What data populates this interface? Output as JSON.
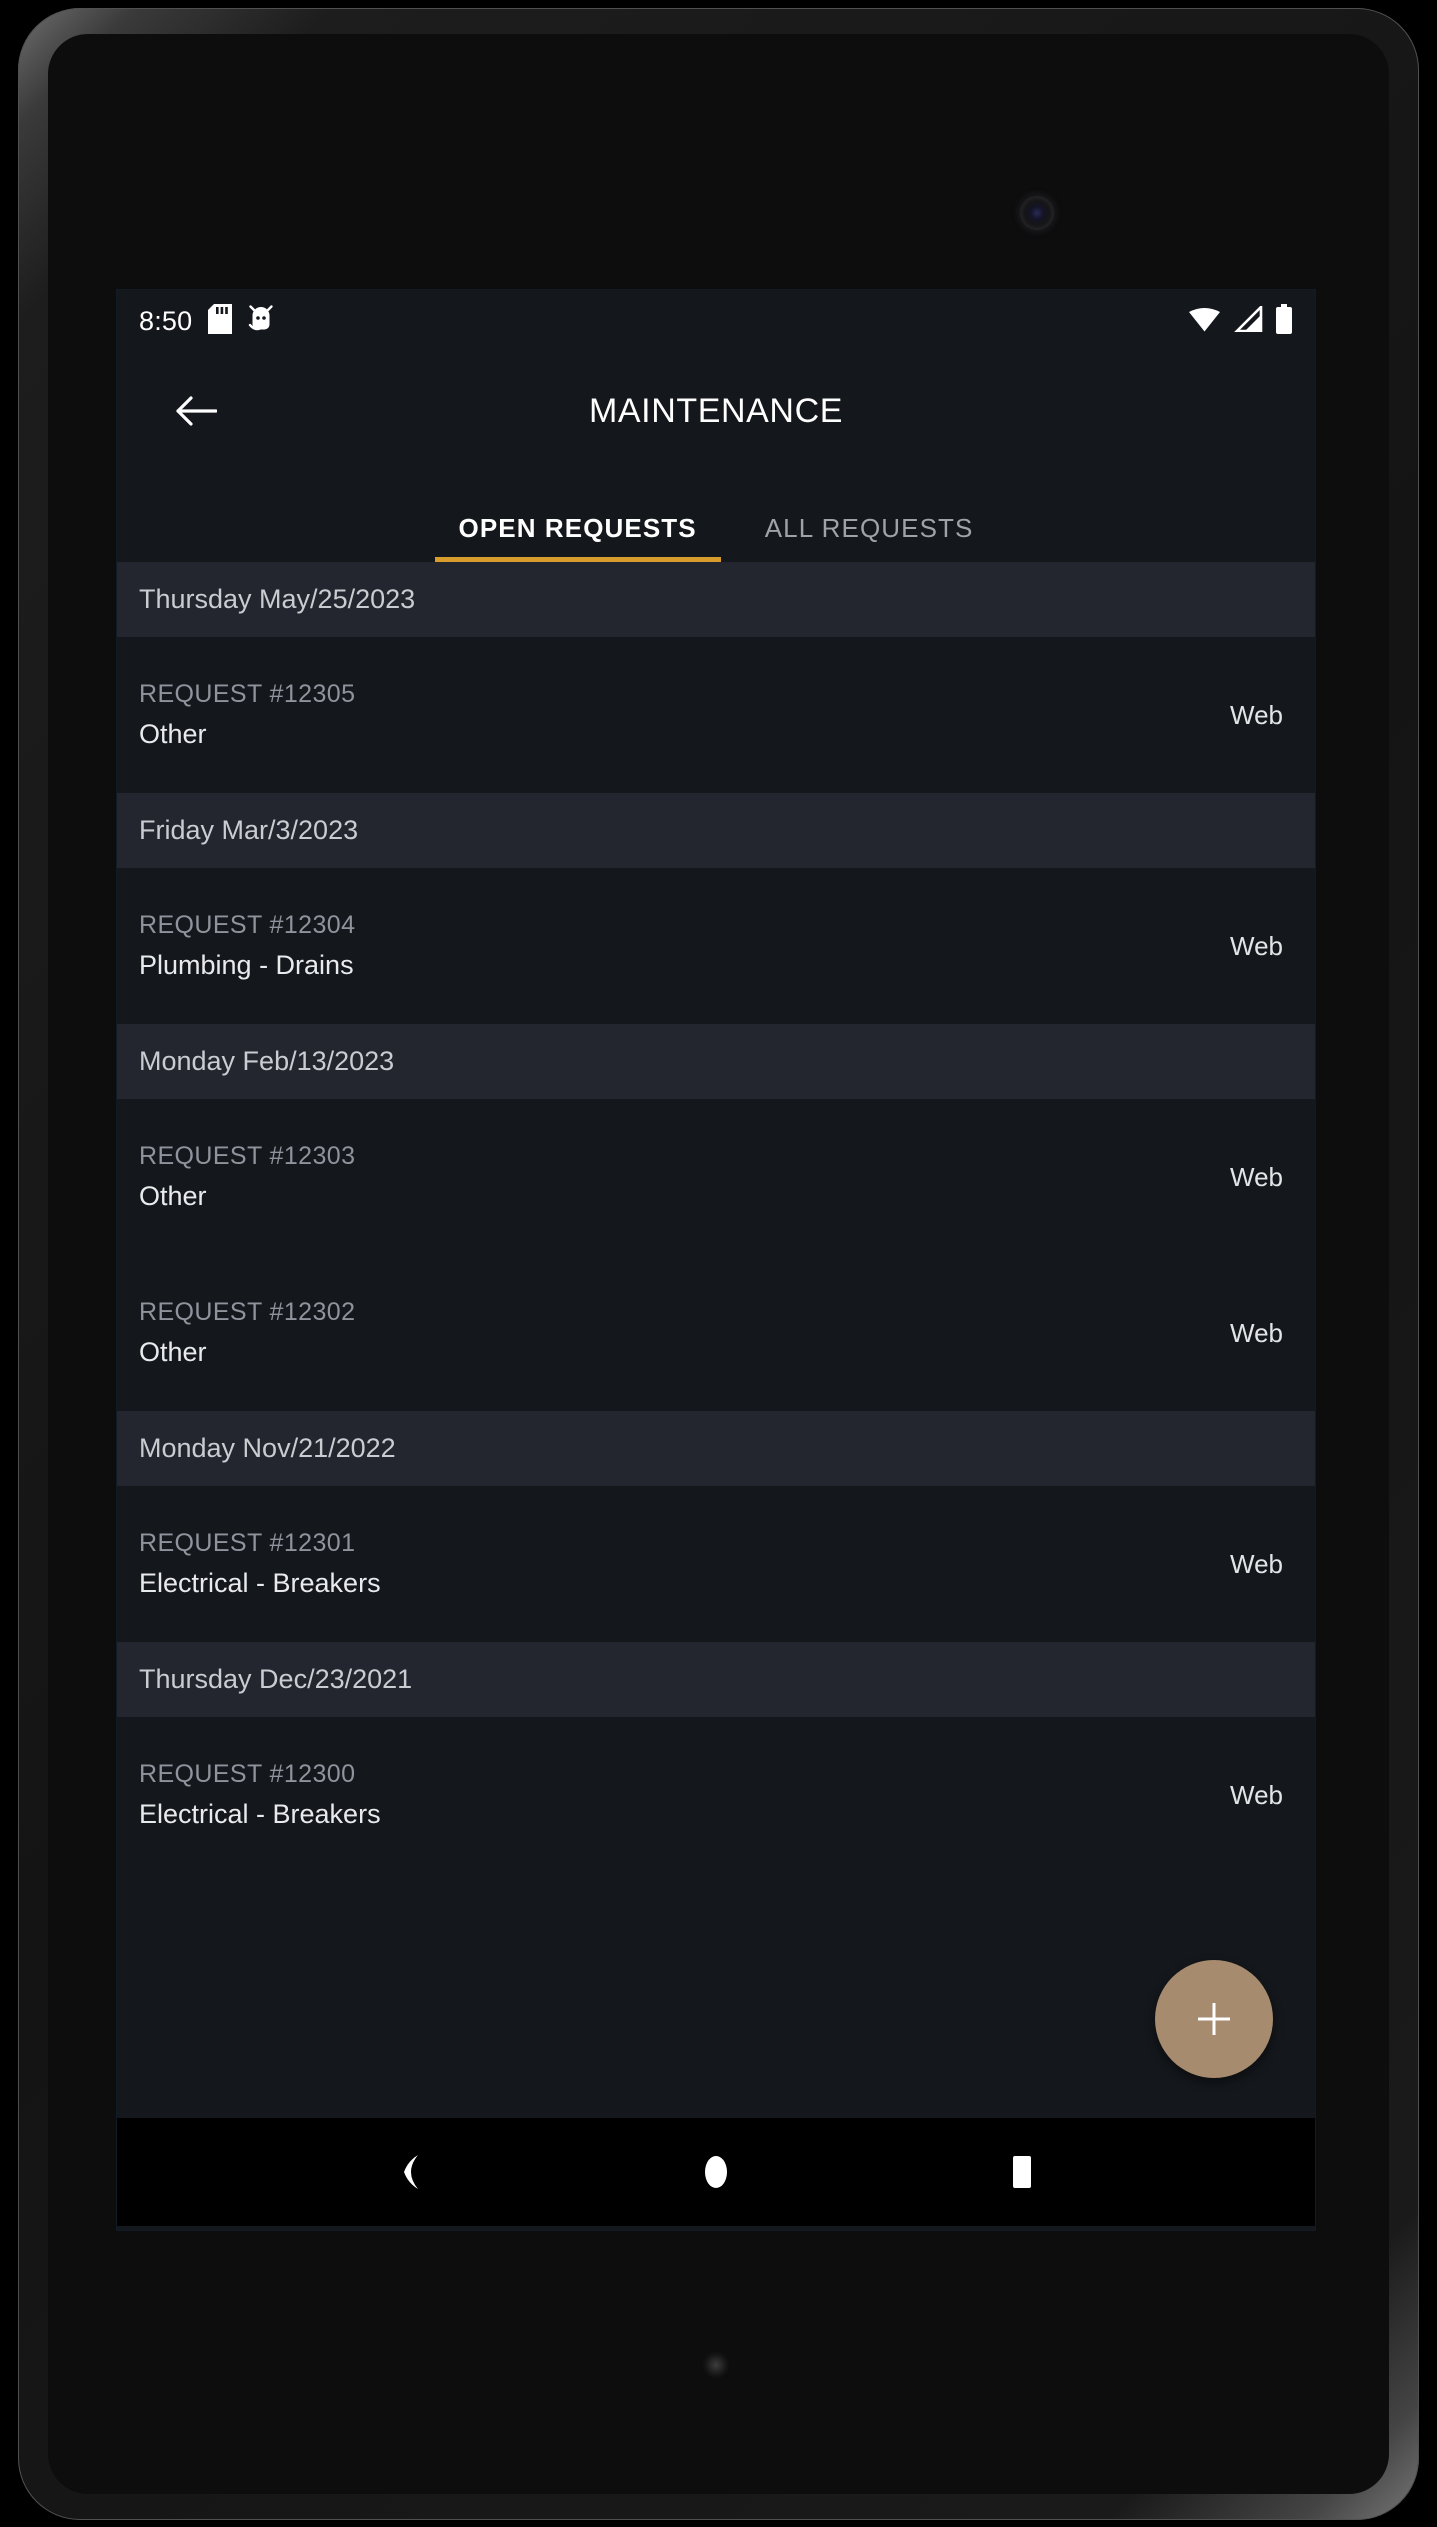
{
  "status_bar": {
    "time": "8:50",
    "left_icons": [
      "sd-card-icon",
      "android-debug-icon"
    ],
    "right_icons": [
      "wifi-icon",
      "cellular-signal-icon",
      "battery-icon"
    ]
  },
  "app_bar": {
    "back_label": "back-arrow",
    "title": "MAINTENANCE"
  },
  "tabs": [
    {
      "label": "OPEN REQUESTS",
      "active": true
    },
    {
      "label": "ALL REQUESTS",
      "active": false
    }
  ],
  "groups": [
    {
      "date": "Thursday May/25/2023",
      "requests": [
        {
          "id": "REQUEST #12305",
          "type": "Other",
          "source": "Web"
        }
      ]
    },
    {
      "date": "Friday Mar/3/2023",
      "requests": [
        {
          "id": "REQUEST #12304",
          "type": "Plumbing - Drains",
          "source": "Web"
        }
      ]
    },
    {
      "date": "Monday Feb/13/2023",
      "requests": [
        {
          "id": "REQUEST #12303",
          "type": "Other",
          "source": "Web"
        },
        {
          "id": "REQUEST #12302",
          "type": "Other",
          "source": "Web"
        }
      ]
    },
    {
      "date": "Monday Nov/21/2022",
      "requests": [
        {
          "id": "REQUEST #12301",
          "type": "Electrical - Breakers",
          "source": "Web"
        }
      ]
    },
    {
      "date": "Thursday Dec/23/2021",
      "requests": [
        {
          "id": "REQUEST #12300",
          "type": "Electrical - Breakers",
          "source": "Web"
        }
      ]
    }
  ],
  "fab": {
    "icon": "plus-icon"
  },
  "nav_bar": {
    "back": "nav-back-triangle",
    "home": "nav-home-circle",
    "recents": "nav-recents-square"
  },
  "colors": {
    "accent": "#d79c2b",
    "fab": "#a68b6f",
    "screen_bg": "#14171b",
    "date_header_bg": "#23262e",
    "primary_text": "#ffffff",
    "muted_text": "#8e939c"
  }
}
